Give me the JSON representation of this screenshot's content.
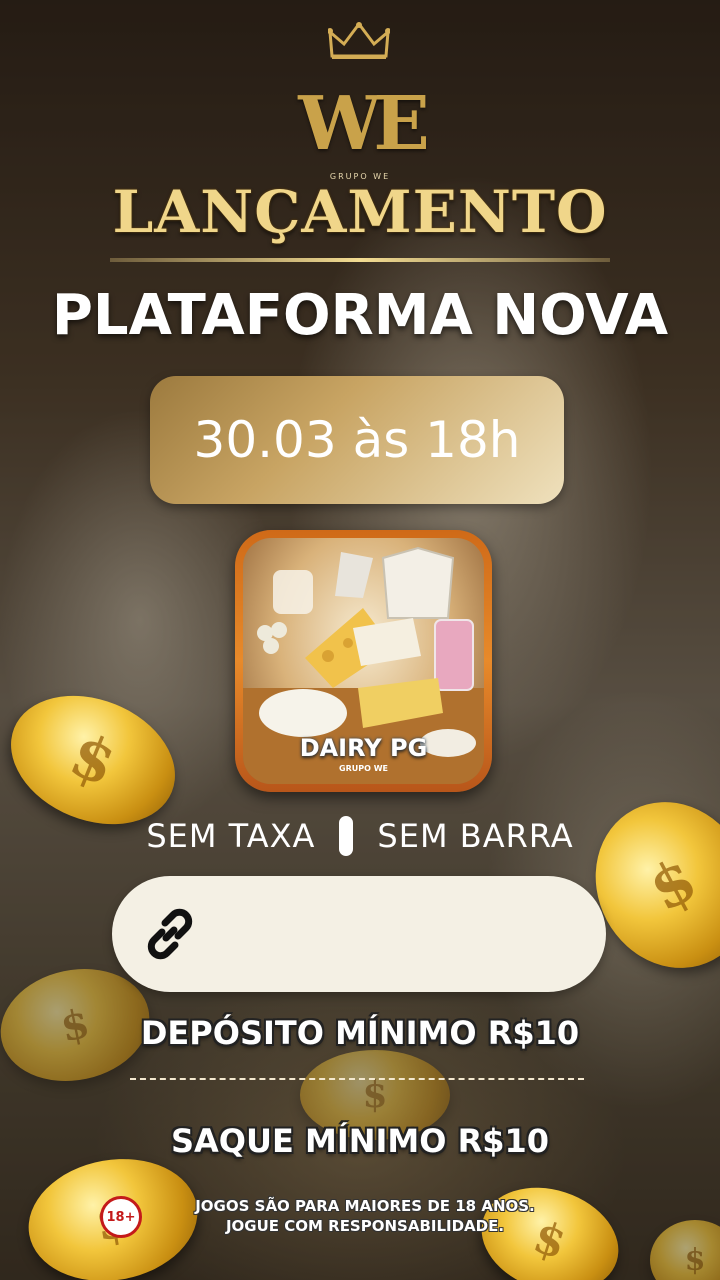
{
  "brand": {
    "logo_text": "WE",
    "logo_sub": "GRUPO WE",
    "icon": "crown-icon"
  },
  "hero": {
    "launch": "LANÇAMENTO",
    "headline": "PLATAFORMA NOVA",
    "date": "30.03 às 18h"
  },
  "app": {
    "name": "DAIRY PG",
    "sub": "GRUPO WE"
  },
  "features": {
    "left": "SEM TAXA",
    "right": "SEM BARRA"
  },
  "link": {
    "icon": "link-icon",
    "value": ""
  },
  "info": {
    "deposit": "DEPÓSITO MÍNIMO R$10",
    "withdraw": "SAQUE MÍNIMO R$10"
  },
  "footer": {
    "age_badge": "18+",
    "line1": "JOGOS SÃO PARA MAIORES DE 18 ANOS.",
    "line2": "JOGUE COM RESPONSABILIDADE."
  },
  "colors": {
    "gold": "#f0d68a",
    "pill_gold": "#c8a463",
    "badge_red": "#c41a1a"
  }
}
